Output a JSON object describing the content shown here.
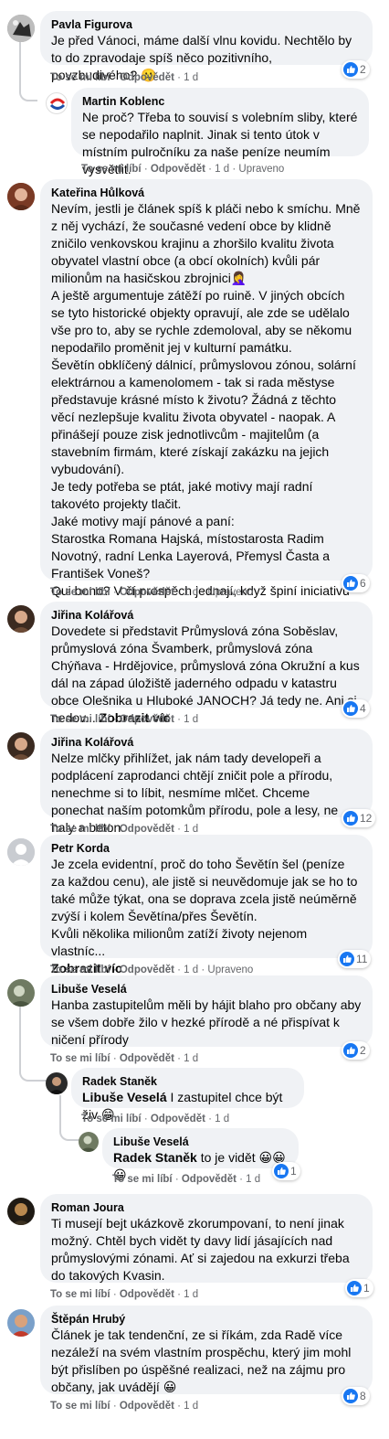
{
  "actions": {
    "like": "To se mi líbí",
    "reply": "Odpovědět",
    "sep": "·",
    "edited": "Upraveno",
    "see_more": "Zobrazit víc"
  },
  "colors": {
    "bubble": "#f0f2f5",
    "like": "#1877f2",
    "meta": "#65676b"
  },
  "comments": [
    {
      "name": "Pavla Figurova",
      "text": "Je před Vánoci, máme další vlnu kovidu. Nechtělo by to do zpravodaje spíš něco pozitivního, povzbudivého? 🙁",
      "time": "1 d",
      "reactions": "2"
    },
    {
      "name": "Martin Koblenc",
      "text": "Ne proč? Třeba to souvisí s volebním sliby, které se nepodařilo naplnit. Jinak si tento útok v místním pulročníku za naše peníze neumím vysvětlit.",
      "time": "1 d",
      "edited": true
    },
    {
      "name": "Kateřina Hůlková",
      "text": "Nevím, jestli je článek spíš k pláči nebo k smíchu. Mně z něj vychází, že současné vedení obce by klidně zničilo venkovskou krajinu a zhoršilo kvalitu života obyvatel vlastní obce (a obcí okolních) kvůli pár milionům na hasičskou zbrojnici🤦‍♀️\nA ještě argumentuje zátěží po ruině. V jiných obcích se tyto historické objekty opravují, ale zde se udělalo vše pro to, aby se rychle zdemoloval, aby se někomu nepodařilo proměnit jej v kulturní památku.\nŠevětín obklíčený dálnicí, průmyslovou zónou, solární elektrárnou a kamenolomem - tak si rada městyse představuje krásné místo k životu? Žádná z těchto věcí nezlepšuje kvalitu života obyvatel - naopak. A přinášejí pouze zisk jednotlivcům - majitelům (a stavebním firmám, které získají zakázku na jejich vybudování).\nJe tedy potřeba se ptát, jaké motivy mají radní takovéto projekty tlačit.\nJaké motivy mají pánové a paní:\nStarostka Romana Hajská, místostarosta Radim Novotný, radní Lenka Layerová, Přemysl Časta a František Voneš?\nQui bono? V čí prospěch jednají, když špiní iniciativu obyvatel obce, kterým není ukradené prostředí v němž budou žít jejich děti?",
      "time": "1 d",
      "edited": true,
      "reactions": "6"
    },
    {
      "name": "Jiřina Kolářová",
      "text": "Dovedete si představit Průmyslová zóna Soběslav, průmyslová zóna Švamberk, průmyslová zóna Chýňava - Hrdějovice, průmyslová zóna Okružní a kus dál na západ úložiště jaderného odpadu v katastru obce Olešnika u Hluboké JANOCH? Já tedy ne. Ani si nedov...",
      "time": "1 d",
      "reactions": "4"
    },
    {
      "name": "Jiřina Kolářová",
      "text": "Nelze mlčky přihlížet, jak nám tady developeři a podplácení zaprodanci chtějí zničit pole a přírodu, nenechme si to líbit, nesmíme mlčet. Chceme ponechat naším potomkům přírodu, pole a lesy, ne haly a beton.",
      "time": "1 d",
      "reactions": "12"
    },
    {
      "name": "Petr Korda",
      "text": "Je zcela evidentní, proč do toho Ševětín šel (peníze za každou cenu), ale jistě si neuvědomuje jak se ho to také může týkat, ona se doprava zcela jistě neúměrně zvýší i kolem Ševětína/přes Ševětín.\nKvůli několika milionům zatíží životy nejenom vlastníc...",
      "time": "1 d",
      "edited": true,
      "reactions": "11"
    },
    {
      "name": "Libuše Veselá",
      "text": "Hanba zastupitelům měli by hájit blaho pro občany aby se všem dobře žilo v hezké přírodě a né přispívat k ničení přírody",
      "time": "1 d",
      "reactions": "2"
    },
    {
      "name": "Radek Staněk",
      "mention": "Libuše Veselá",
      "text": " I zastupitel chce být živ 😁",
      "time": "1 d"
    },
    {
      "name": "Libuše Veselá",
      "mention": "Radek Staněk",
      "text": " to je vidět 😀😀😀",
      "time": "1 d",
      "reactions": "1"
    },
    {
      "name": "Roman Joura",
      "text": "Ti musejí bejt ukázkově zkorumpovaní, to není jinak možný. Chtěl bych vidět ty davy lidí jásajících nad průmyslovými zónami. Ať si zajedou na exkurzi třeba do takových Kvasin.",
      "time": "1 d",
      "reactions": "1"
    },
    {
      "name": "Štěpán Hrubý",
      "text": "Článek je tak tendenční, ze si říkám, zda Radě více nezáleží na svém vlastním prospěchu, který jim mohl být přislíben po úspěšné realizaci, než na zájmu pro občany, jak uvádějí 😀",
      "time": "1 d",
      "reactions": "8"
    }
  ]
}
